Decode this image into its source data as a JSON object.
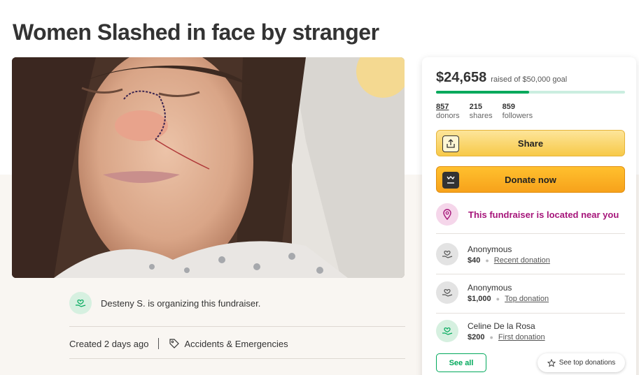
{
  "page": {
    "title": "Women Slashed in face by stranger"
  },
  "organizer": {
    "text": "Desteny S. is organizing this fundraiser."
  },
  "meta": {
    "created": "Created 2 days ago",
    "category": "Accidents & Emergencies"
  },
  "card": {
    "raised": "$24,658",
    "goal_text": "raised of $50,000 goal",
    "progress_fraction": 0.493,
    "stats": [
      {
        "num": "857",
        "label": "donors"
      },
      {
        "num": "215",
        "label": "shares"
      },
      {
        "num": "859",
        "label": "followers"
      }
    ],
    "share_label": "Share",
    "donate_label": "Donate now",
    "location_text": "This fundraiser is located near you",
    "donations": [
      {
        "name": "Anonymous",
        "amount": "$40",
        "type": "Recent donation",
        "avatar": "grey"
      },
      {
        "name": "Anonymous",
        "amount": "$1,000",
        "type": "Top donation",
        "avatar": "grey"
      },
      {
        "name": "Celine De la Rosa",
        "amount": "$200",
        "type": "First donation",
        "avatar": "green"
      }
    ],
    "see_all_label": "See all",
    "see_top_label": "See top donations"
  },
  "colors": {
    "accent_green": "#02a95c",
    "location_magenta": "#a6157a",
    "donate_orange": "#f7a21b",
    "share_yellow": "#f7c948"
  },
  "icons": {
    "share": "share-upload-icon",
    "donate": "gofundme-logo-icon",
    "location": "map-pin-icon",
    "donor": "heart-hand-icon",
    "tag": "tag-icon",
    "star": "star-outline-icon"
  }
}
